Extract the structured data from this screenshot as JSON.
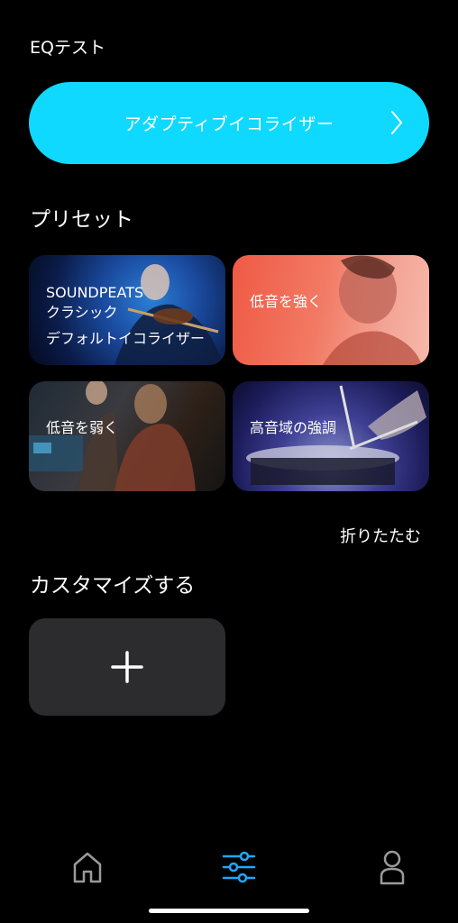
{
  "eq_section": {
    "title": "EQテスト"
  },
  "adaptive_eq": {
    "label": "アダプティブイコライザー"
  },
  "presets": {
    "title": "プリセット",
    "cards": [
      {
        "line1": "SOUNDPEATS",
        "line2": "クラシック",
        "line3": "デフォルトイコライザー"
      },
      {
        "label": "低音を強く"
      },
      {
        "label": "低音を弱く"
      },
      {
        "label": "高音域の強調"
      }
    ],
    "collapse_label": "折りたたむ"
  },
  "custom": {
    "title": "カスタマイズする"
  },
  "nav": {
    "items": [
      "home-icon",
      "equalizer-sliders-icon",
      "profile-icon"
    ],
    "active_color": "#1ea8ff"
  },
  "colors": {
    "accent": "#0fd9ff",
    "card_bg": "#2c2c2e",
    "background": "#000000"
  }
}
